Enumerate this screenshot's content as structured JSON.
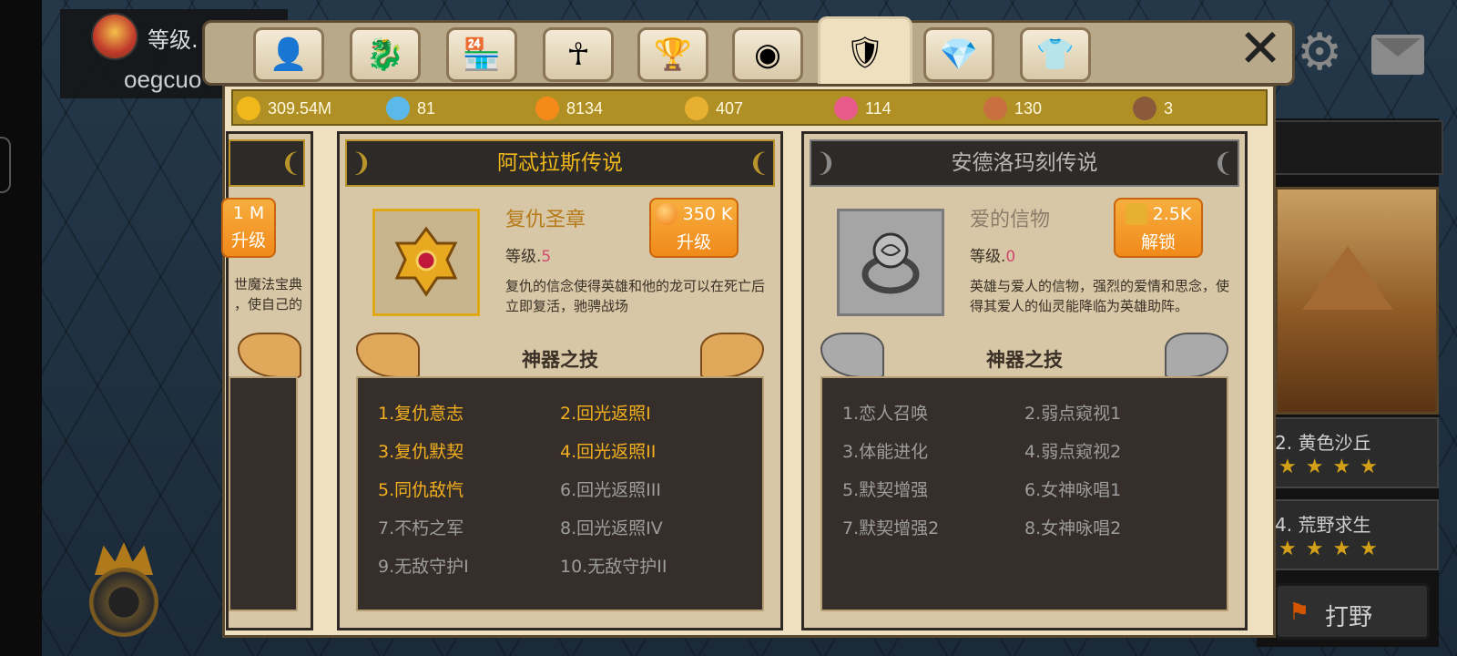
{
  "player": {
    "level_label": "等级.",
    "name": "oegcuo"
  },
  "tabs": [
    {
      "icon": "person-icon",
      "glyph": "👤"
    },
    {
      "icon": "dragon-head-icon",
      "glyph": "🐉"
    },
    {
      "icon": "shop-icon",
      "glyph": "🏪"
    },
    {
      "icon": "ankh-icon",
      "glyph": "☥"
    },
    {
      "icon": "trophy-icon",
      "glyph": "🏆"
    },
    {
      "icon": "blue-orb-icon",
      "glyph": "◉"
    },
    {
      "icon": "artifact-icon",
      "glyph": "🛡"
    },
    {
      "icon": "gem-icon",
      "glyph": "💎"
    },
    {
      "icon": "shirt-icon",
      "glyph": "👕"
    }
  ],
  "currencies": [
    {
      "icon": "gold-coin-icon",
      "color": "#f0b81a",
      "value": "309.54M"
    },
    {
      "icon": "diamond-icon",
      "color": "#5ab8ea",
      "value": "81"
    },
    {
      "icon": "orange-orb-icon",
      "color": "#f38a1a",
      "value": "8134"
    },
    {
      "icon": "puzzle-gold-icon",
      "color": "#e8b030",
      "value": "407"
    },
    {
      "icon": "puzzle-pink-icon",
      "color": "#e85a8a",
      "value": "114"
    },
    {
      "icon": "puzzle-red-icon",
      "color": "#c87040",
      "value": "130"
    },
    {
      "icon": "shell-icon",
      "color": "#8a5a3a",
      "value": "3"
    }
  ],
  "partial_card": {
    "action_value": "1 M",
    "action_label": "升级",
    "desc_line1": "世魔法宝典",
    "desc_line2": "，使自己的"
  },
  "cards": [
    {
      "title": "阿忒拉斯传说",
      "item_name": "复仇圣章",
      "level_label": "等级.",
      "level_value": "5",
      "action_value": "350 K",
      "action_label": "升级",
      "action_icon": "orange-orb-icon",
      "description": "复仇的信念使得英雄和他的龙可以在死亡后立即复活，驰骋战场",
      "skills_title": "神器之技",
      "skills": [
        {
          "text": "1.复仇意志",
          "on": true
        },
        {
          "text": "2.回光返照I",
          "on": true
        },
        {
          "text": "3.复仇默契",
          "on": true
        },
        {
          "text": "4.回光返照II",
          "on": true
        },
        {
          "text": "5.同仇敌忾",
          "on": true
        },
        {
          "text": "6.回光返照III",
          "on": false
        },
        {
          "text": "7.不朽之军",
          "on": false
        },
        {
          "text": "8.回光返照IV",
          "on": false
        },
        {
          "text": "9.无敌守护I",
          "on": false
        },
        {
          "text": "10.无敌守护II",
          "on": false
        }
      ]
    },
    {
      "title": "安德洛玛刻传说",
      "item_name": "爱的信物",
      "level_label": "等级.",
      "level_value": "0",
      "action_value": "2.5K",
      "action_label": "解锁",
      "action_icon": "puzzle-gold-icon",
      "description": "英雄与爱人的信物，强烈的爱情和思念，使得其爱人的仙灵能降临为英雄助阵。",
      "skills_title": "神器之技",
      "skills": [
        {
          "text": "1.恋人召唤",
          "on": false
        },
        {
          "text": "2.弱点窥视1",
          "on": false
        },
        {
          "text": "3.体能进化",
          "on": false
        },
        {
          "text": "4.弱点窥视2",
          "on": false
        },
        {
          "text": "5.默契增强",
          "on": false
        },
        {
          "text": "6.女神咏唱1",
          "on": false
        },
        {
          "text": "7.默契增强2",
          "on": false
        },
        {
          "text": "8.女神咏唱2",
          "on": false
        }
      ]
    }
  ],
  "right_panel": {
    "stage_a": "2. 黄色沙丘",
    "stage_b": "4. 荒野求生",
    "stars": "★★★★",
    "wild_label": "打野"
  }
}
